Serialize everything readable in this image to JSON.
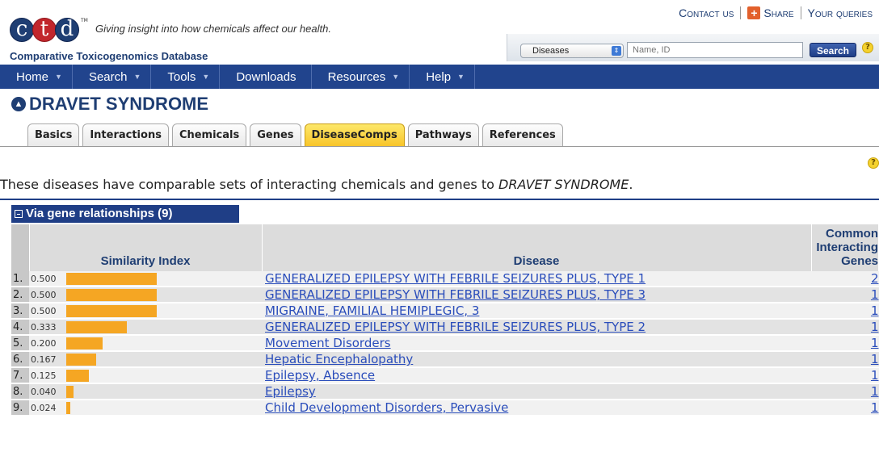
{
  "header": {
    "logo_letters": [
      "c",
      "t",
      "d"
    ],
    "logo_tm": "TM",
    "tagline": "Giving insight into how chemicals affect our health.",
    "subtitle": "Comparative Toxicogenomics Database",
    "links": {
      "contact": "Contact us",
      "share": "Share",
      "queries": "Your queries"
    }
  },
  "search": {
    "select_value": "Diseases",
    "placeholder": "Name, ID",
    "button": "Search"
  },
  "nav": [
    {
      "label": "Home"
    },
    {
      "label": "Search"
    },
    {
      "label": "Tools"
    },
    {
      "label": "Downloads"
    },
    {
      "label": "Resources"
    },
    {
      "label": "Help"
    }
  ],
  "page_title": "DRAVET SYNDROME",
  "tabs": [
    "Basics",
    "Interactions",
    "Chemicals",
    "Genes",
    "DiseaseComps",
    "Pathways",
    "References"
  ],
  "active_tab": "DiseaseComps",
  "intro": {
    "text": "These diseases have comparable sets of interacting chemicals and genes to ",
    "disease": "DRAVET SYNDROME",
    "end": "."
  },
  "section": {
    "title": "Via gene relationships (9)"
  },
  "table": {
    "headers": {
      "similarity": "Similarity Index",
      "disease": "Disease",
      "common": [
        "Common",
        "Interacting",
        "Genes"
      ]
    },
    "rows": [
      {
        "index": "1.",
        "similarity": "0.500",
        "score": 0.5,
        "disease": "GENERALIZED EPILEPSY WITH FEBRILE SEIZURES PLUS, TYPE 1",
        "genes": "2"
      },
      {
        "index": "2.",
        "similarity": "0.500",
        "score": 0.5,
        "disease": "GENERALIZED EPILEPSY WITH FEBRILE SEIZURES PLUS, TYPE 3",
        "genes": "1"
      },
      {
        "index": "3.",
        "similarity": "0.500",
        "score": 0.5,
        "disease": "MIGRAINE, FAMILIAL HEMIPLEGIC, 3",
        "genes": "1"
      },
      {
        "index": "4.",
        "similarity": "0.333",
        "score": 0.333,
        "disease": "GENERALIZED EPILEPSY WITH FEBRILE SEIZURES PLUS, TYPE 2",
        "genes": "1"
      },
      {
        "index": "5.",
        "similarity": "0.200",
        "score": 0.2,
        "disease": "Movement Disorders",
        "genes": "1"
      },
      {
        "index": "6.",
        "similarity": "0.167",
        "score": 0.167,
        "disease": "Hepatic Encephalopathy",
        "genes": "1"
      },
      {
        "index": "7.",
        "similarity": "0.125",
        "score": 0.125,
        "disease": "Epilepsy, Absence",
        "genes": "1"
      },
      {
        "index": "8.",
        "similarity": "0.040",
        "score": 0.04,
        "disease": "Epilepsy",
        "genes": "1"
      },
      {
        "index": "9.",
        "similarity": "0.024",
        "score": 0.024,
        "disease": "Child Development Disorders, Pervasive",
        "genes": "1"
      }
    ]
  },
  "colors": {
    "brand": "#1f3e73",
    "nav": "#21448d",
    "bar": "#f5a623",
    "link": "#2a4dbb",
    "active_tab": "#f8c52a"
  }
}
